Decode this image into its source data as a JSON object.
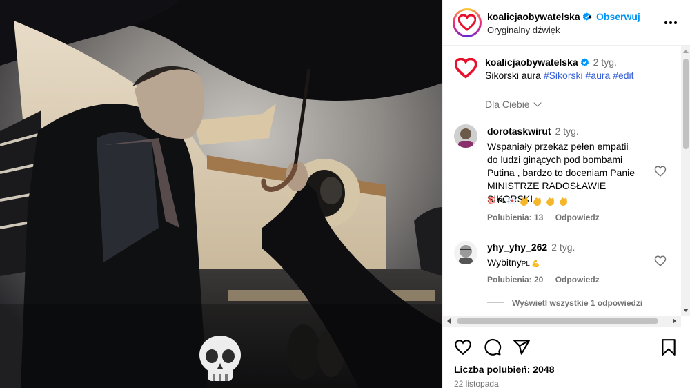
{
  "header": {
    "username": "koalicjaobywatelska",
    "follow_label": "Obserwuj",
    "separator": "•",
    "audio": "Oryginalny dźwięk"
  },
  "caption": {
    "username": "koalicjaobywatelska",
    "time": "2 tyg.",
    "text": "Sikorski aura",
    "hashtags": [
      "#Sikorski",
      "#aura",
      "#edit"
    ]
  },
  "for_you_label": "Dla Ciebie",
  "comments": [
    {
      "username": "dorotaskwirut",
      "time": "2 tyg.",
      "lines": [
        "Wspaniały przekaz pełen empatii",
        "do ludzi ginących pod bombami",
        "Putina , bardzo to doceniam Panie",
        "MINISTRZE RADOSŁAWIE SIKORSKI"
      ],
      "emoji_text": "💯 PL 💌",
      "likes_label": "Polubienia: 13",
      "reply_label": "Odpowiedz"
    },
    {
      "username": "yhy_yhy_262",
      "time": "2 tyg.",
      "text": "Wybitny",
      "emoji_text": "PL 💪",
      "likes_label": "Polubienia: 20",
      "reply_label": "Odpowiedz",
      "view_replies_label": "Wyświetl wszystkie 1 odpowiedzi"
    }
  ],
  "footer": {
    "likes_label": "Liczba polubień: 2048",
    "date": "22 listopada"
  },
  "colors": {
    "accent_blue": "#0095f6",
    "heart_red": "#e8112d",
    "muted": "#737373"
  },
  "icons": [
    "heart-logo-icon",
    "verified-icon",
    "more-icon",
    "heart-icon",
    "comment-icon",
    "share-icon",
    "bookmark-icon",
    "skull-icon",
    "clap-icon"
  ]
}
